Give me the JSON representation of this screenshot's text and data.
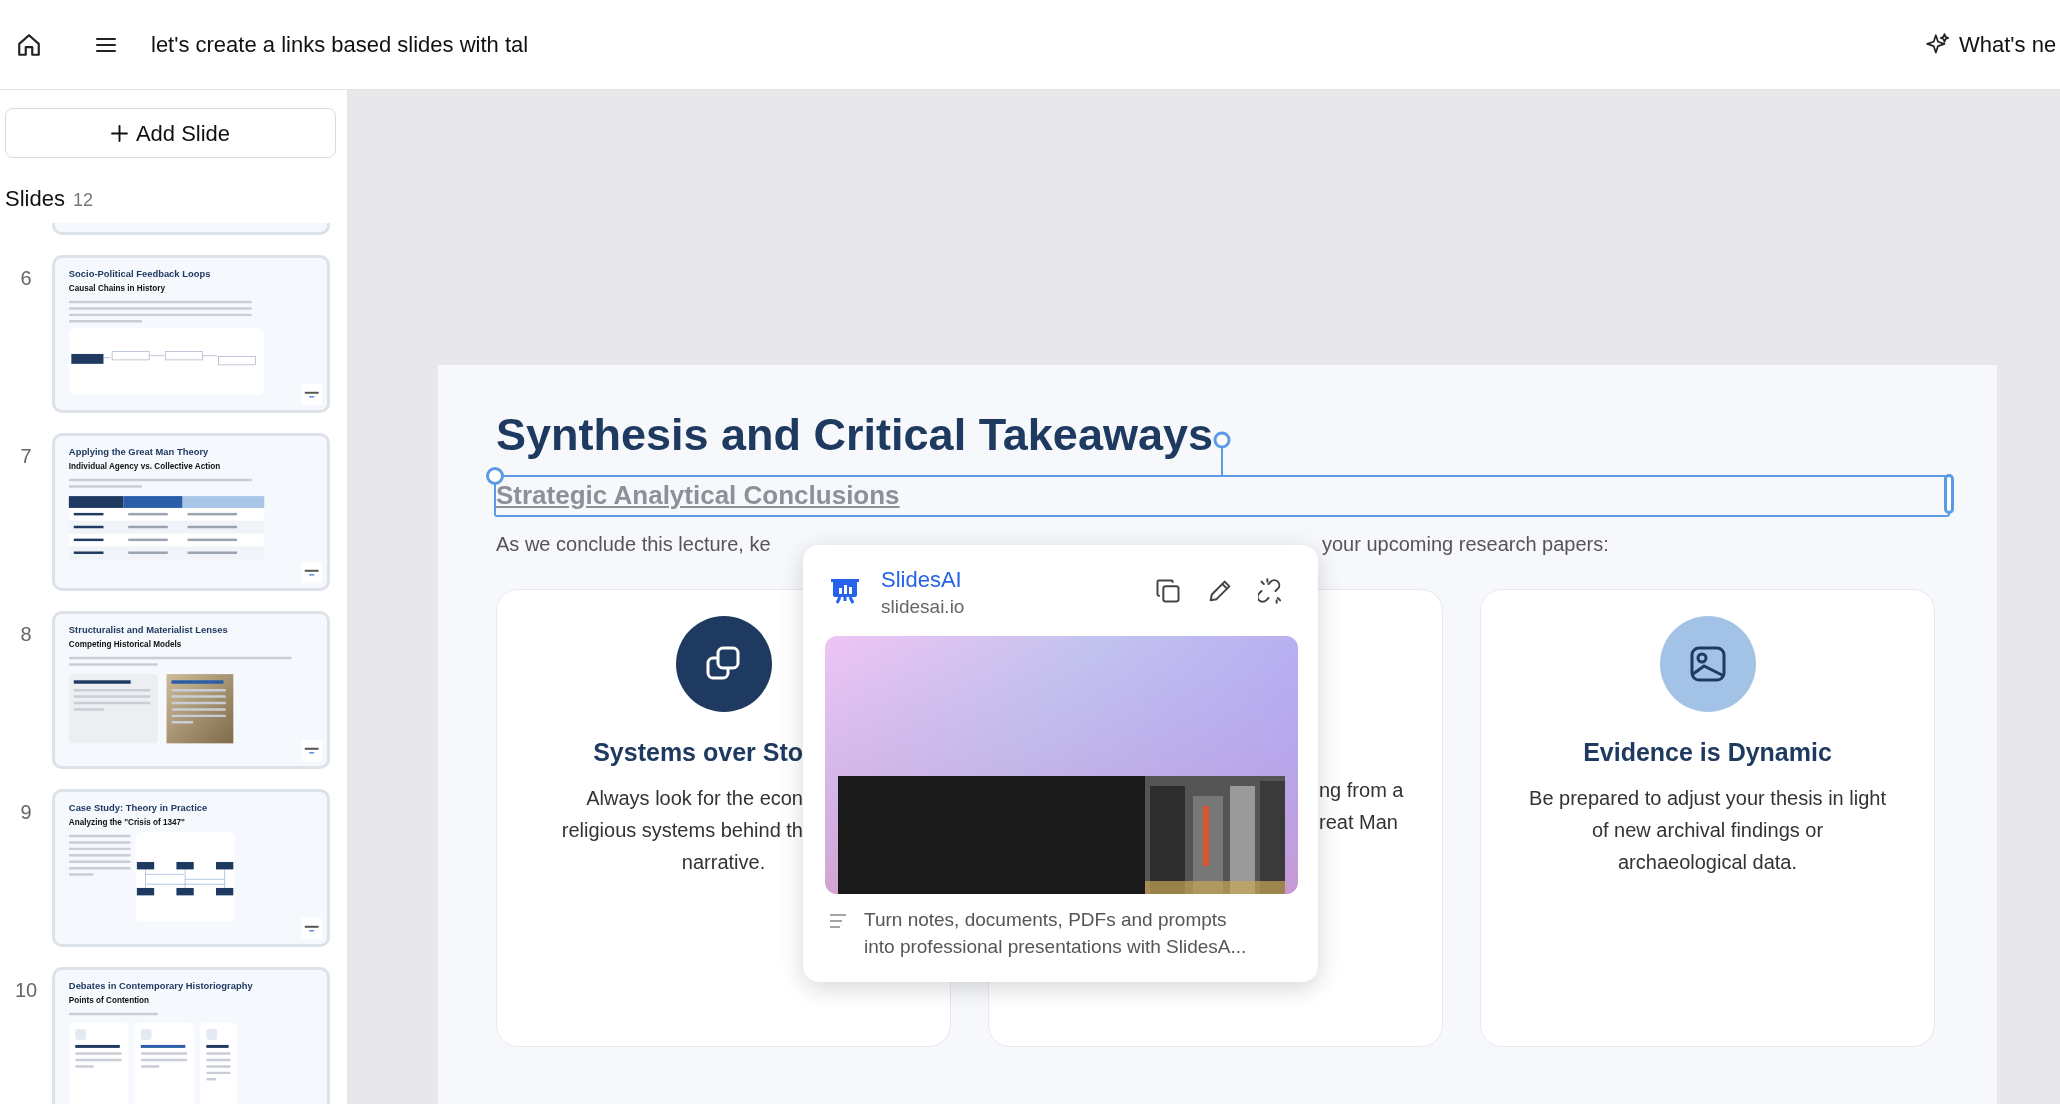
{
  "header": {
    "title": "let's create a links based slides with tal",
    "whats_new": "What's ne"
  },
  "sidebar": {
    "add_slide": "Add Slide",
    "slides_label": "Slides",
    "slides_count": "12",
    "thumbnails": [
      {
        "kind": "partial"
      },
      {
        "kind": "diagram",
        "number": "6",
        "title": "Socio-Political Feedback Loops",
        "subtitle": "Causal Chains in History"
      },
      {
        "kind": "table",
        "number": "7",
        "title": "Applying the Great Man Theory",
        "subtitle": "Individual Agency vs. Collective Action"
      },
      {
        "kind": "panels",
        "number": "8",
        "title": "Structuralist and Materialist Lenses",
        "subtitle": "Competing Historical Models"
      },
      {
        "kind": "sequence",
        "number": "9",
        "title": "Case Study: Theory in Practice",
        "subtitle": "Analyzing the \"Crisis of 1347\""
      },
      {
        "kind": "cards",
        "number": "10",
        "title": "Debates in Contemporary Historiography",
        "subtitle": "Points of Contention"
      }
    ]
  },
  "slide": {
    "title": "Synthesis and Critical Takeaways",
    "subtitle": {
      "text": "Strategic Analytical Conclusions",
      "selected": true
    },
    "intro": [
      "As we conclude this lecture, ke",
      "your upcoming research papers:"
    ],
    "cards": [
      {
        "heading": {
          "text": "Systems over Sto",
          "cut": true
        },
        "color": "#1f3a60",
        "lines": [
          {
            "text": "Always look for the econ",
            "cut": true
          },
          {
            "text": "religious systems behind th",
            "cut": true
          },
          {
            "text": "narrative.",
            "cut": false
          }
        ]
      },
      {
        "lines": [
          {
            "text": "ng from a",
            "cut": true
          },
          {
            "text": "reat Man",
            "cut": true
          }
        ]
      },
      {
        "heading": {
          "text": "Evidence is Dynamic"
        },
        "color": "#a3c3e6",
        "lines": [
          {
            "text": "Be prepared to adjust your thesis in light"
          },
          {
            "text": "of new archival findings or"
          },
          {
            "text": "archaeological data."
          }
        ]
      }
    ]
  },
  "link_popup": {
    "site_name": "SlidesAI",
    "domain": "slidesai.io",
    "preview": {
      "kind": "picture"
    },
    "description": [
      "Turn notes, documents, PDFs and prompts",
      "into professional presentations with SlidesA..."
    ]
  }
}
